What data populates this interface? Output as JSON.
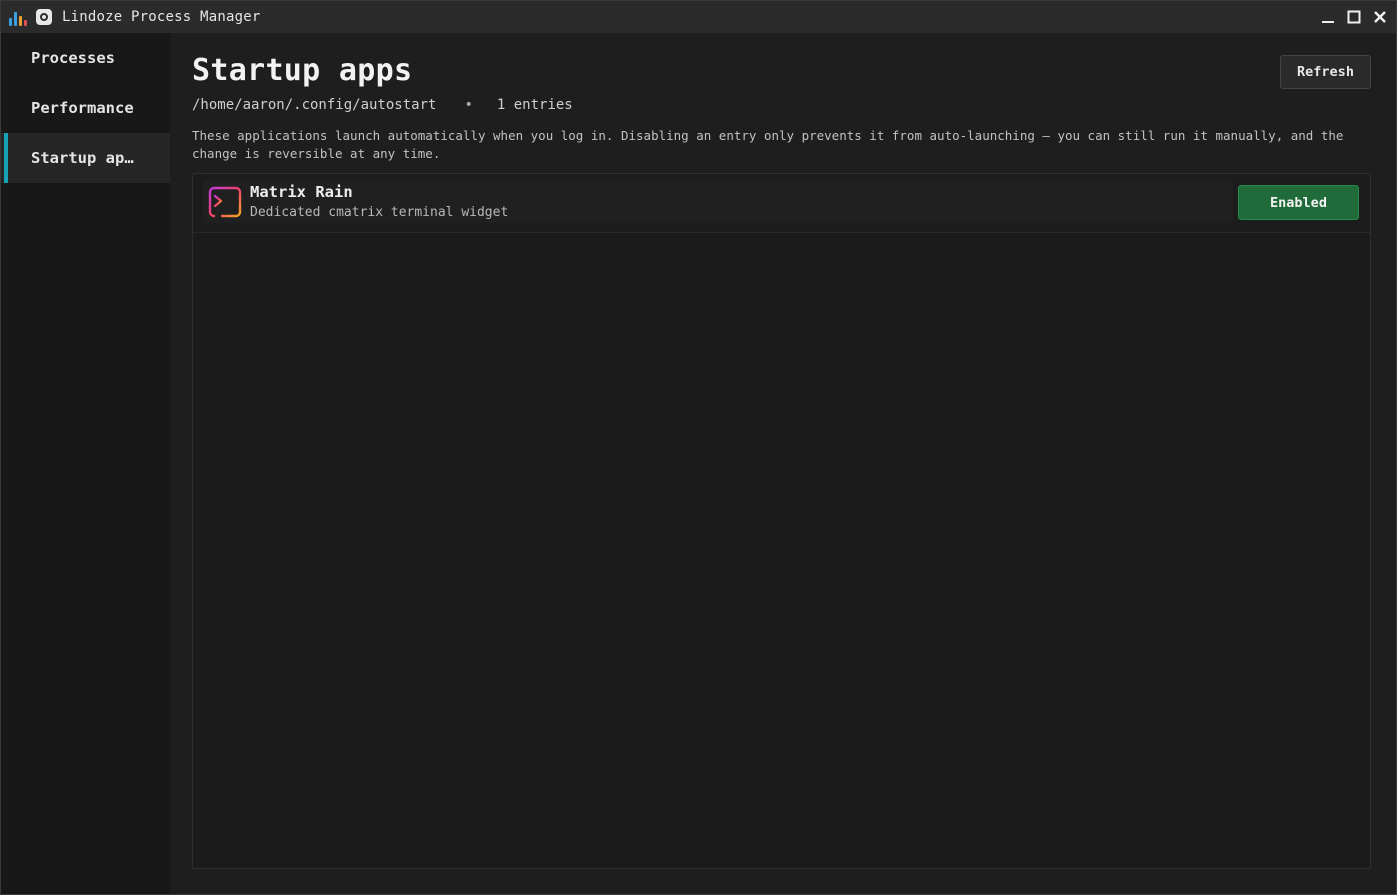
{
  "window": {
    "title": "Lindoze Process Manager",
    "app_icon": "bar-chart-icon",
    "menu_icon": "app-menu-icon",
    "controls": [
      "minimize-icon",
      "maximize-icon",
      "close-icon"
    ]
  },
  "sidebar": {
    "items": [
      {
        "label": "Processes",
        "active": false
      },
      {
        "label": "Performance",
        "active": false
      },
      {
        "label": "Startup ap…",
        "active": true
      }
    ],
    "accent_color": "#17a2b8"
  },
  "main": {
    "title": "Startup apps",
    "path": "/home/aaron/.config/autostart",
    "separator": "•",
    "entry_count": "1 entries",
    "refresh_label": "Refresh",
    "description": "These applications launch automatically when you log in. Disabling an entry only prevents it from auto-launching — you can still run it manually, and the change is reversible at any time."
  },
  "entries": [
    {
      "name": "Matrix Rain",
      "description": "Dedicated cmatrix terminal widget",
      "icon": "terminal-icon",
      "status_label": "Enabled",
      "status_color": "#1f6b39"
    }
  ]
}
